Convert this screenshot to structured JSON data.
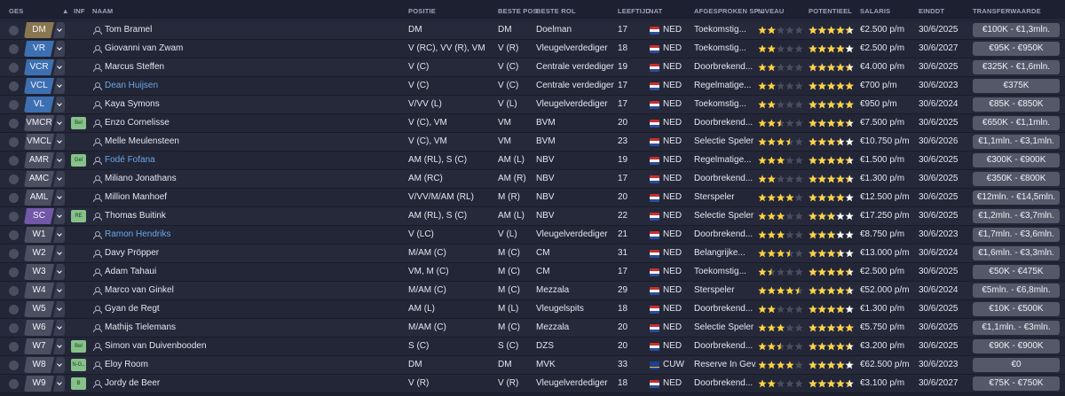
{
  "colors": {
    "star_full": "#ffd23f",
    "star_empty": "#4a4d5d",
    "potential_star": "#ffffff"
  },
  "headers": [
    {
      "key": "ges",
      "label": "GES"
    },
    {
      "key": "sort",
      "label": "▲"
    },
    {
      "key": "inf",
      "label": "INF"
    },
    {
      "key": "naam",
      "label": "NAAM"
    },
    {
      "key": "positie",
      "label": "POSITIE"
    },
    {
      "key": "beste_pos",
      "label": "BESTE POS"
    },
    {
      "key": "beste_rol",
      "label": "BESTE ROL"
    },
    {
      "key": "leeftijd",
      "label": "LEEFTIJD"
    },
    {
      "key": "nat",
      "label": "NAT"
    },
    {
      "key": "afgesproken",
      "label": "AFGESPROKEN SP..."
    },
    {
      "key": "niveau",
      "label": "NIVEAU"
    },
    {
      "key": "potentieel",
      "label": "POTENTIEEL"
    },
    {
      "key": "salaris",
      "label": "SALARIS"
    },
    {
      "key": "einddt",
      "label": "EINDDT"
    },
    {
      "key": "transferwaarde",
      "label": "TRANSFERWAARDE"
    }
  ],
  "players": [
    {
      "ges": "DM",
      "ges_color": "gold",
      "inf": "",
      "name": "Tom Bramel",
      "link": false,
      "positie": "DM",
      "beste_pos": "DM",
      "beste_rol": "Doelman",
      "leeftijd": "17",
      "nat": "NED",
      "flag": "ned",
      "afgesproken": "Toekomstig...",
      "niveau": 2,
      "potentieel": 4.5,
      "salaris": "€2.500 p/m",
      "einddt": "30/6/2025",
      "transferwaarde": "€100K - €1,3mln."
    },
    {
      "ges": "VR",
      "ges_color": "blue",
      "inf": "",
      "name": "Giovanni van Zwam",
      "link": false,
      "positie": "V (RC), VV (R), VM",
      "beste_pos": "V (R)",
      "beste_rol": "Vleugelverdediger",
      "leeftijd": "18",
      "nat": "NED",
      "flag": "ned",
      "afgesproken": "Toekomstig...",
      "niveau": 2,
      "potentieel": 4,
      "salaris": "€2.500 p/m",
      "einddt": "30/6/2027",
      "transferwaarde": "€95K - €950K"
    },
    {
      "ges": "VCR",
      "ges_color": "blue",
      "inf": "",
      "name": "Marcus Steffen",
      "link": false,
      "positie": "V (C)",
      "beste_pos": "V (C)",
      "beste_rol": "Centrale verdediger",
      "leeftijd": "19",
      "nat": "NED",
      "flag": "ned",
      "afgesproken": "Doorbrekend...",
      "niveau": 2,
      "potentieel": 4.5,
      "salaris": "€4.000 p/m",
      "einddt": "30/6/2025",
      "transferwaarde": "€325K - €1,6mln."
    },
    {
      "ges": "VCL",
      "ges_color": "blue",
      "inf": "",
      "name": "Dean Huijsen",
      "link": true,
      "positie": "V (C)",
      "beste_pos": "V (C)",
      "beste_rol": "Centrale verdediger",
      "leeftijd": "17",
      "nat": "NED",
      "flag": "ned",
      "afgesproken": "Regelmatige...",
      "niveau": 2,
      "potentieel": 5,
      "salaris": "€700 p/m",
      "einddt": "30/6/2023",
      "transferwaarde": "€375K"
    },
    {
      "ges": "VL",
      "ges_color": "blue",
      "inf": "",
      "name": "Kaya Symons",
      "link": false,
      "positie": "V/VV (L)",
      "beste_pos": "V (L)",
      "beste_rol": "Vleugelverdediger",
      "leeftijd": "17",
      "nat": "NED",
      "flag": "ned",
      "afgesproken": "Toekomstig...",
      "niveau": 2,
      "potentieel": 5,
      "salaris": "€950 p/m",
      "einddt": "30/6/2024",
      "transferwaarde": "€85K - €850K"
    },
    {
      "ges": "VMCR",
      "ges_color": "grey",
      "inf": "Bel",
      "name": "Enzo Cornelisse",
      "link": false,
      "positie": "V (C), VM",
      "beste_pos": "VM",
      "beste_rol": "BVM",
      "leeftijd": "20",
      "nat": "NED",
      "flag": "ned",
      "afgesproken": "Doorbrekend...",
      "niveau": 2.5,
      "potentieel": 4.5,
      "salaris": "€7.500 p/m",
      "einddt": "30/6/2025",
      "transferwaarde": "€650K - €1,1mln."
    },
    {
      "ges": "VMCL",
      "ges_color": "grey",
      "inf": "",
      "name": "Melle Meulensteen",
      "link": false,
      "positie": "V (C), VM",
      "beste_pos": "VM",
      "beste_rol": "BVM",
      "leeftijd": "23",
      "nat": "NED",
      "flag": "ned",
      "afgesproken": "Selectie Speler",
      "niveau": 3.5,
      "potentieel": 3.5,
      "salaris": "€10.750 p/m",
      "einddt": "30/6/2026",
      "transferwaarde": "€1,1mln. - €3,1mln."
    },
    {
      "ges": "AMR",
      "ges_color": "grey",
      "inf": "Gel",
      "name": "Fodé Fofana",
      "link": true,
      "positie": "AM (RL), S (C)",
      "beste_pos": "AM (L)",
      "beste_rol": "NBV",
      "leeftijd": "19",
      "nat": "NED",
      "flag": "ned",
      "afgesproken": "Regelmatige...",
      "niveau": 3,
      "potentieel": 4.5,
      "salaris": "€1.500 p/m",
      "einddt": "30/6/2025",
      "transferwaarde": "€300K - €900K"
    },
    {
      "ges": "AMC",
      "ges_color": "grey",
      "inf": "",
      "name": "Miliano Jonathans",
      "link": false,
      "positie": "AM (RC)",
      "beste_pos": "AM (R)",
      "beste_rol": "NBV",
      "leeftijd": "17",
      "nat": "NED",
      "flag": "ned",
      "afgesproken": "Doorbrekend...",
      "niveau": 2,
      "potentieel": 4.5,
      "salaris": "€1.300 p/m",
      "einddt": "30/6/2025",
      "transferwaarde": "€350K - €800K"
    },
    {
      "ges": "AML",
      "ges_color": "grey",
      "inf": "",
      "name": "Million Manhoef",
      "link": false,
      "positie": "V/VV/M/AM (RL)",
      "beste_pos": "M (R)",
      "beste_rol": "NBV",
      "leeftijd": "20",
      "nat": "NED",
      "flag": "ned",
      "afgesproken": "Sterspeler",
      "niveau": 4,
      "potentieel": 4,
      "salaris": "€12.500 p/m",
      "einddt": "30/6/2025",
      "transferwaarde": "€12mln. - €14,5mln."
    },
    {
      "ges": "SC",
      "ges_color": "purple",
      "inf": "RE",
      "name": "Thomas Buitink",
      "link": false,
      "positie": "AM (RL), S (C)",
      "beste_pos": "AM (L)",
      "beste_rol": "NBV",
      "leeftijd": "22",
      "nat": "NED",
      "flag": "ned",
      "afgesproken": "Selectie Speler",
      "niveau": 3,
      "potentieel": 3,
      "salaris": "€17.250 p/m",
      "einddt": "30/6/2025",
      "transferwaarde": "€1,2mln. - €3,7mln."
    },
    {
      "ges": "W1",
      "ges_color": "grey",
      "inf": "",
      "name": "Ramon Hendriks",
      "link": true,
      "positie": "V (LC)",
      "beste_pos": "V (L)",
      "beste_rol": "Vleugelverdediger",
      "leeftijd": "21",
      "nat": "NED",
      "flag": "ned",
      "afgesproken": "Doorbrekend...",
      "niveau": 3,
      "potentieel": 3,
      "salaris": "€8.750 p/m",
      "einddt": "30/6/2023",
      "transferwaarde": "€1,7mln. - €3,6mln."
    },
    {
      "ges": "W2",
      "ges_color": "grey",
      "inf": "",
      "name": "Davy Pröpper",
      "link": false,
      "positie": "M/AM (C)",
      "beste_pos": "M (C)",
      "beste_rol": "CM",
      "leeftijd": "31",
      "nat": "NED",
      "flag": "ned",
      "afgesproken": "Belangrijke...",
      "niveau": 3.5,
      "potentieel": 3.5,
      "salaris": "€13.000 p/m",
      "einddt": "30/6/2024",
      "transferwaarde": "€1,6mln. - €3,3mln."
    },
    {
      "ges": "W3",
      "ges_color": "grey",
      "inf": "",
      "name": "Adam Tahaui",
      "link": false,
      "positie": "VM, M (C)",
      "beste_pos": "M (C)",
      "beste_rol": "CM",
      "leeftijd": "17",
      "nat": "NED",
      "flag": "ned",
      "afgesproken": "Toekomstig...",
      "niveau": 1.5,
      "potentieel": 4.5,
      "salaris": "€2.500 p/m",
      "einddt": "30/6/2025",
      "transferwaarde": "€50K - €475K"
    },
    {
      "ges": "W4",
      "ges_color": "grey",
      "inf": "",
      "name": "Marco van Ginkel",
      "link": false,
      "positie": "M/AM (C)",
      "beste_pos": "M (C)",
      "beste_rol": "Mezzala",
      "leeftijd": "29",
      "nat": "NED",
      "flag": "ned",
      "afgesproken": "Sterspeler",
      "niveau": 4.5,
      "potentieel": 4.5,
      "salaris": "€52.000 p/m",
      "einddt": "30/6/2024",
      "transferwaarde": "€5mln. - €6,8mln."
    },
    {
      "ges": "W5",
      "ges_color": "grey",
      "inf": "",
      "name": "Gyan de Regt",
      "link": false,
      "positie": "AM (L)",
      "beste_pos": "M (L)",
      "beste_rol": "Vleugelspits",
      "leeftijd": "18",
      "nat": "NED",
      "flag": "ned",
      "afgesproken": "Doorbrekend...",
      "niveau": 2,
      "potentieel": 4,
      "salaris": "€1.300 p/m",
      "einddt": "30/6/2025",
      "transferwaarde": "€10K - €500K"
    },
    {
      "ges": "W6",
      "ges_color": "grey",
      "inf": "",
      "name": "Mathijs Tielemans",
      "link": false,
      "positie": "M/AM (C)",
      "beste_pos": "M (C)",
      "beste_rol": "Mezzala",
      "leeftijd": "20",
      "nat": "NED",
      "flag": "ned",
      "afgesproken": "Selectie Speler",
      "niveau": 3,
      "potentieel": 5,
      "salaris": "€5.750 p/m",
      "einddt": "30/6/2025",
      "transferwaarde": "€1,1mln. - €3mln."
    },
    {
      "ges": "W7",
      "ges_color": "grey",
      "inf": "Bel",
      "name": "Simon van Duivenbooden",
      "link": false,
      "positie": "S (C)",
      "beste_pos": "S (C)",
      "beste_rol": "DZS",
      "leeftijd": "20",
      "nat": "NED",
      "flag": "ned",
      "afgesproken": "Doorbrekend...",
      "niveau": 2.5,
      "potentieel": 4.5,
      "salaris": "€3.200 p/m",
      "einddt": "30/6/2025",
      "transferwaarde": "€90K - €900K"
    },
    {
      "ges": "W8",
      "ges_color": "grey",
      "inf": "N-G..",
      "name": "Eloy Room",
      "link": false,
      "positie": "DM",
      "beste_pos": "DM",
      "beste_rol": "MVK",
      "leeftijd": "33",
      "nat": "CUW",
      "flag": "cuw",
      "afgesproken": "Reserve In Gev...",
      "niveau": 4,
      "potentieel": 4,
      "salaris": "€62.500 p/m",
      "einddt": "30/6/2023",
      "transferwaarde": "€0"
    },
    {
      "ges": "W9",
      "ges_color": "grey",
      "inf": "B",
      "name": "Jordy de Beer",
      "link": false,
      "positie": "V (R)",
      "beste_pos": "V (R)",
      "beste_rol": "Vleugelverdediger",
      "leeftijd": "18",
      "nat": "NED",
      "flag": "ned",
      "afgesproken": "Doorbrekend...",
      "niveau": 2,
      "potentieel": 4.5,
      "salaris": "€3.100 p/m",
      "einddt": "30/6/2027",
      "transferwaarde": "€75K - €750K"
    }
  ]
}
